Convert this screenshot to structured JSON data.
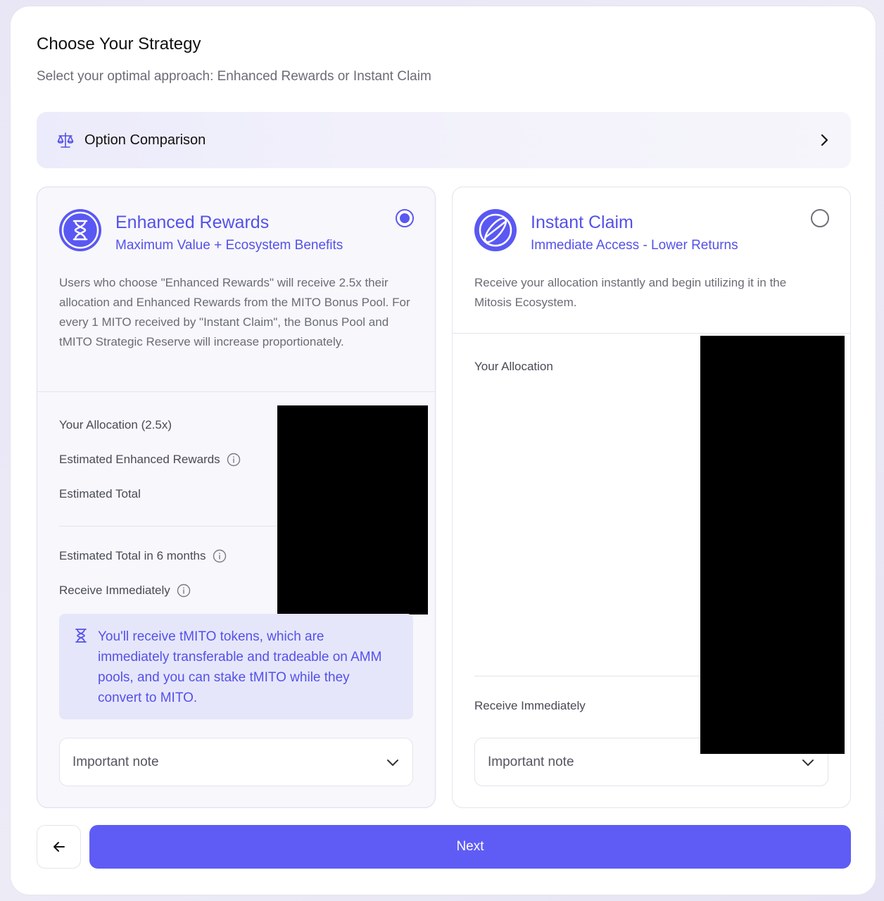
{
  "header": {
    "title": "Choose Your Strategy",
    "subtitle": "Select your optimal approach: Enhanced Rewards or Instant Claim"
  },
  "comparison": {
    "label": "Option Comparison",
    "icon": "scale-icon"
  },
  "enhanced": {
    "title": "Enhanced Rewards",
    "subtitle": "Maximum Value + Ecosystem Benefits",
    "description": "Users who choose \"Enhanced Rewards\" will receive 2.5x their allocation and Enhanced Rewards from the MITO Bonus Pool. For every 1 MITO received by \"Instant Claim\", the Bonus Pool and tMITO Strategic Reserve will increase proportionately.",
    "selected": true,
    "rows": {
      "allocation": "Your Allocation (2.5x)",
      "rewards": "Estimated Enhanced Rewards",
      "total": "Estimated Total",
      "total6m": "Estimated Total in 6 months",
      "immediate": "Receive Immediately"
    },
    "tip": "You'll receive tMITO tokens, which are immediately transferable and tradeable on AMM pools, and you can stake tMITO while they convert to MITO.",
    "note": "Important note"
  },
  "instant": {
    "title": "Instant Claim",
    "subtitle": "Immediate Access - Lower Returns",
    "description": "Receive your allocation instantly and begin utilizing it in the Mitosis Ecosystem.",
    "selected": false,
    "rows": {
      "allocation": "Your Allocation",
      "immediate": "Receive Immediately"
    },
    "note": "Important note"
  },
  "footer": {
    "next_label": "Next",
    "back_icon": "arrow-left-icon"
  },
  "colors": {
    "accent": "#5F5CF6",
    "accent_text": "#5451E8",
    "tip_bg": "#E6E6FB"
  }
}
